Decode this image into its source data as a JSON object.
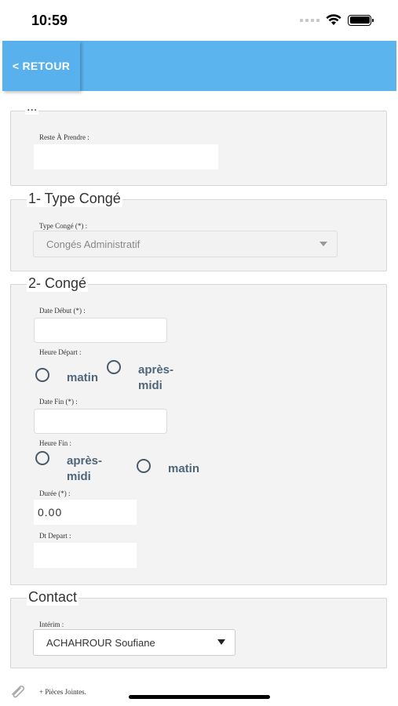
{
  "status_bar": {
    "time": "10:59"
  },
  "header": {
    "back_label": "< RETOUR"
  },
  "section_summary": {
    "legend": "...",
    "reste_label": "Reste À Prendre :",
    "reste_value": ""
  },
  "section_type": {
    "legend": "1- Type Congé",
    "type_label": "Type Congé (*) :",
    "type_value": "Congés Administratif"
  },
  "section_conge": {
    "legend": "2- Congé",
    "date_debut_label": "Date Début (*) :",
    "date_debut_value": "",
    "heure_depart_label": "Heure Départ :",
    "heure_depart_options": [
      "matin",
      "après-\nmidi"
    ],
    "date_fin_label": "Date Fin (*) :",
    "date_fin_value": "",
    "heure_fin_label": "Heure Fin :",
    "heure_fin_options": [
      "après-\nmidi",
      "matin"
    ],
    "duree_label": "Durée (*) :",
    "duree_value": "0.00",
    "dt_depart_label": "Dt Depart :",
    "dt_depart_value": ""
  },
  "section_contact": {
    "legend": "Contact",
    "interim_label": "Intérim :",
    "interim_value": "ACHAHROUR Soufiane"
  },
  "footer": {
    "attachments_label": "+ Pièces Jointes."
  }
}
